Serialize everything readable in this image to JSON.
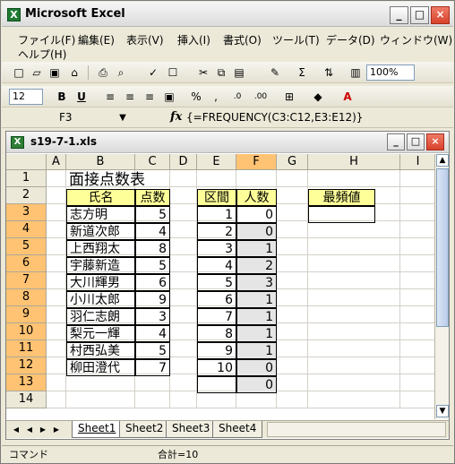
{
  "app": {
    "title": "Microsoft Excel",
    "window_controls": [
      "_",
      "□",
      "×"
    ]
  },
  "menu": [
    "ファイル(F)",
    "編集(E)",
    "表示(V)",
    "挿入(I)",
    "書式(O)",
    "ツール(T)",
    "データ(D)",
    "ウィンドウ(W)",
    "ヘルプ(H)"
  ],
  "toolbar": {
    "zoom": "100%",
    "font_size": "12"
  },
  "formula_bar": {
    "name_box": "F3",
    "formula": "{=FREQUENCY(C3:C12,E3:E12)}"
  },
  "workbook": {
    "title": "s19-7-1.xls",
    "columns": [
      "A",
      "B",
      "C",
      "D",
      "E",
      "F",
      "G",
      "H",
      "I"
    ],
    "rows": [
      "1",
      "2",
      "3",
      "4",
      "5",
      "6",
      "7",
      "8",
      "9",
      "10",
      "11",
      "12",
      "13",
      "14"
    ],
    "title_cell": "面接点数表",
    "headers": {
      "name": "氏名",
      "score": "点数",
      "interval": "区間",
      "count": "人数",
      "mode": "最頻値"
    },
    "names": [
      "志方明",
      "新道次郎",
      "上西翔太",
      "宇藤新造",
      "大川輝男",
      "小川太郎",
      "羽仁志朗",
      "梨元一輝",
      "村西弘美",
      "柳田澄代"
    ],
    "scores": [
      5,
      4,
      8,
      5,
      6,
      9,
      3,
      4,
      5,
      7
    ],
    "intervals": [
      1,
      2,
      3,
      4,
      5,
      6,
      7,
      8,
      9,
      10
    ],
    "counts": [
      0,
      0,
      1,
      2,
      3,
      1,
      1,
      1,
      1,
      0,
      0
    ]
  },
  "sheets": [
    "Sheet1",
    "Sheet2",
    "Sheet3",
    "Sheet4"
  ],
  "status": {
    "mode": "コマンド",
    "sum": "合計=10"
  }
}
